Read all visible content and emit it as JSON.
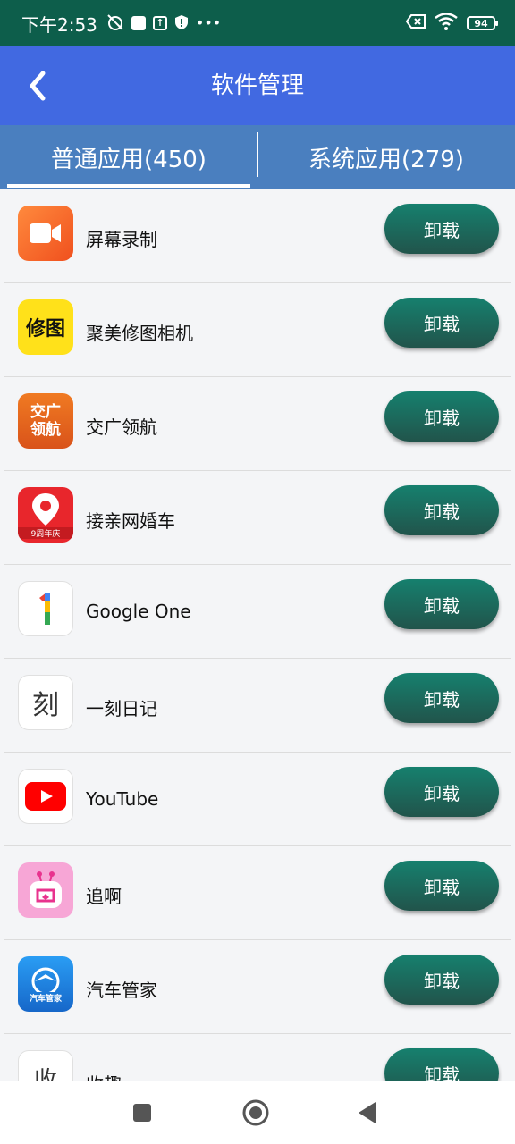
{
  "status_bar": {
    "time": "下午2:53",
    "battery": "94"
  },
  "header": {
    "title": "软件管理"
  },
  "tabs": [
    {
      "label": "普通应用(450)",
      "active": true
    },
    {
      "label": "系统应用(279)",
      "active": false
    }
  ],
  "apps": [
    {
      "name": "屏幕录制",
      "icon": "screen-record-icon",
      "action": "卸载"
    },
    {
      "name": "聚美修图相机",
      "icon": "photo-edit-icon",
      "icon_text": "修图",
      "action": "卸载"
    },
    {
      "name": "交广领航",
      "icon": "jiaoguang-icon",
      "icon_text_line1": "交广",
      "icon_text_line2": "领航",
      "action": "卸载"
    },
    {
      "name": "接亲网婚车",
      "icon": "wedding-car-icon",
      "icon_text": "9周年庆",
      "action": "卸载"
    },
    {
      "name": "Google One",
      "icon": "google-one-icon",
      "action": "卸载"
    },
    {
      "name": "一刻日记",
      "icon": "diary-icon",
      "icon_text": "刻",
      "action": "卸载"
    },
    {
      "name": "YouTube",
      "icon": "youtube-icon",
      "action": "卸载"
    },
    {
      "name": "追啊",
      "icon": "zhuia-icon",
      "action": "卸载"
    },
    {
      "name": "汽车管家",
      "icon": "car-manager-icon",
      "icon_text": "汽车管家",
      "action": "卸载"
    },
    {
      "name": "收趣",
      "icon": "shouqu-icon",
      "icon_text": "收",
      "action": "卸载"
    }
  ],
  "colors": {
    "status_bar": "#0d5e4b",
    "header": "#4169e1",
    "tabs": "#4a7fbf",
    "button": "#1a6b5e"
  }
}
